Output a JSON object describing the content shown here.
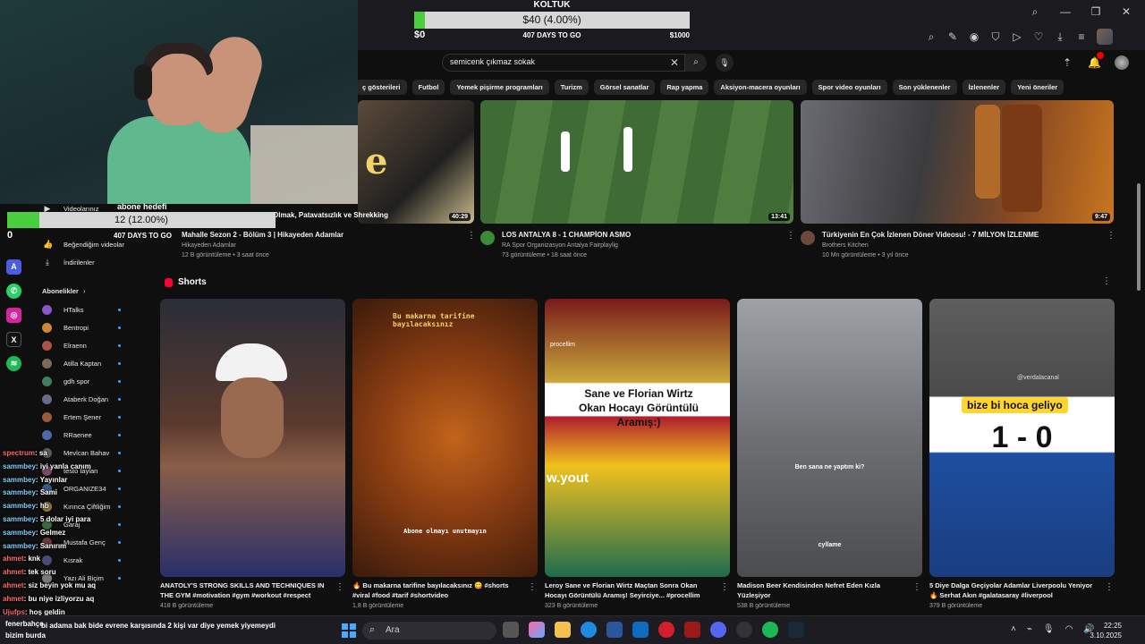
{
  "goal": {
    "title": "KOLTUK",
    "value_text": "$40 (4.00%)",
    "progress": 0.04,
    "min": "$0",
    "days": "407 DAYS TO GO",
    "max": "$1000"
  },
  "sub_goal": {
    "title": "abone hedefi",
    "value_text": "12 (12.00%)",
    "progress": 0.12,
    "min": "0",
    "days": "407 DAYS TO GO"
  },
  "search": {
    "query": "semicenk çıkmaz sokak"
  },
  "chips": [
    "ç gösterileri",
    "Futbol",
    "Yemek pişirme programları",
    "Turizm",
    "Görsel sanatlar",
    "Rap yapma",
    "Aksiyon-macera oyunları",
    "Spor video oyunları",
    "Son yüklenenler",
    "İzlenenler",
    "Yeni öneriler"
  ],
  "videos": [
    {
      "title": "Mahalle Sezon 2 - Bölüm 3 (Olmak, Patavatsızlık ve Shrekking",
      "title_short": "Mahalle Sezon 2 - Bölüm 3 | Hikayeden Adamlar",
      "channel": "Hikayeden Adamlar",
      "meta": "12 B görüntüleme • 3 saat önce",
      "duration": "40:29"
    },
    {
      "title": "LOS ANTALYA 8 - 1 CHAMPİON ASMO",
      "channel": "RA Spor Organizasyon Antalya Fairplaylig",
      "meta": "73 görüntüleme • 18 saat önce",
      "duration": "13:41"
    },
    {
      "title": "Türkiyenin En Çok İzlenen Döner Videosu! - 7 MİLYON İZLENME",
      "channel": "Brothers Kitchen",
      "meta": "10 Mn görüntüleme • 3 yıl önce",
      "duration": "9:47"
    }
  ],
  "thumb_overlay": "Olmak, Patavatsızlık ve Shrekking",
  "sidebar": {
    "items": [
      "Videolarınız",
      "Beğendiğim videolar",
      "İndirilenler"
    ],
    "subs_header": "Abonelikler",
    "subs": [
      "HTalks",
      "Bentropi",
      "Elraenn",
      "Atilla Kaptan",
      "gdh spor",
      "Ataberk Doğan",
      "Ertem Şener",
      "RRaenee",
      "Mevlcan Bahav",
      "testo taylan",
      "ORGANIZE34",
      "Kırınca Çiftliğim",
      "Garaj",
      "Mustafa Genç",
      "Kısrak",
      "Yazı Ali Biçim"
    ]
  },
  "chat": [
    {
      "user": "spectrum",
      "msg": "sa"
    },
    {
      "user": "sammbey",
      "msg": "iyi yanla canım"
    },
    {
      "user": "sammbey",
      "msg": "Yayınlar"
    },
    {
      "user": "sammbey",
      "msg": "Sami"
    },
    {
      "user": "sammbey",
      "msg": "hb"
    },
    {
      "user": "sammbey",
      "msg": "5 dolar iyi para"
    },
    {
      "user": "sammbey",
      "msg": "Gelmez"
    },
    {
      "user": "sammbey",
      "msg": "Sanırım"
    },
    {
      "user": "ahmet",
      "msg": "knk"
    },
    {
      "user": "ahmet",
      "msg": "tek soru"
    },
    {
      "user": "ahmet",
      "msg": "siz beyin yok mu aq"
    },
    {
      "user": "ahmet",
      "msg": "bu niye izliyorzu aq"
    },
    {
      "user": "Ujufps",
      "msg": "hoş geldin"
    }
  ],
  "shorts": {
    "header": "Shorts",
    "items": [
      {
        "title": "ANATOLY'S STRONG SKILLS AND TECHNIQUES IN THE GYM #motivation #gym #workout #respect",
        "meta": "418 B görüntüleme",
        "overlay": ""
      },
      {
        "title": "🔥 Bu makarna tarifine bayılacaksınız 😋 #shorts #viral #food #tarif #shortvideo",
        "meta": "1,8 B görüntüleme",
        "overlay": "Bu makarna tarifine bayılacaksınız",
        "overlay2": "Abone olmayı unutmayın"
      },
      {
        "title": "Leroy Sane ve Florian Wirtz Maçtan Sonra Okan Hocayı Görüntülü Aramış! Seyirciye... #procellim",
        "meta": "323 B görüntüleme",
        "overlay": "Sane ve Florian Wirtz Okan Hocayı Görüntülü Aramış:)",
        "overlay2": "procellim",
        "overlay3": "w.yout"
      },
      {
        "title": "Madison Beer Kendisinden Nefret Eden Kızla Yüzleşiyor",
        "meta": "538 B görüntüleme",
        "overlay": "Ben sana ne yaptım ki?",
        "overlay2": "cyllame"
      },
      {
        "title": "5 Diye Dalga Geçiyolar Adamlar Liverpoolu Yeniyor 🔥 Serhat Akın #galatasaray #liverpool",
        "meta": "379 B görüntüleme",
        "overlay": "bize bi hoca geliyo",
        "overlay2": "1 - 0",
        "overlay3": "@verdalacanal"
      }
    ]
  },
  "taskbar": {
    "search_placeholder": "Ara",
    "ticker": "bi adama bak bide evrene karşısında 2 kişi var diye yemek yiyemeydi",
    "status1": "fenerbahçe",
    "status2": "bizim burda",
    "time": "22:25",
    "date": "3.10.2025"
  },
  "colors": {
    "goal_fill": "#49cf3e",
    "accent_red": "#ff0033",
    "bg": "#0f0f0f"
  }
}
